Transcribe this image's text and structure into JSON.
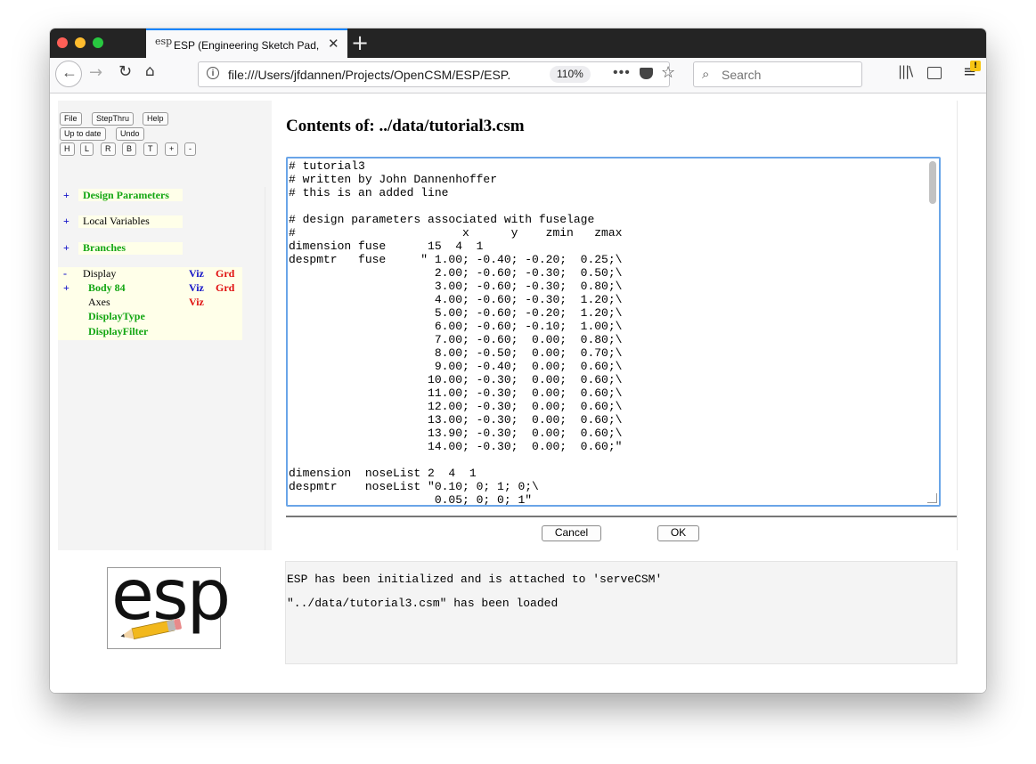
{
  "browser": {
    "tab_title": "ESP (Engineering Sketch Pad, V",
    "tab_favicon": "esp",
    "url": "file:///Users/jfdannen/Projects/OpenCSM/ESP/ESP.",
    "zoom": "110%",
    "search_placeholder": "Search",
    "icons": [
      "back-icon",
      "forward-icon",
      "reload-icon",
      "home-icon",
      "info-icon",
      "more-icon",
      "pocket-icon",
      "bookmark-star-icon",
      "search-icon",
      "library-icon",
      "sidebar-icon",
      "menu-icon"
    ]
  },
  "toolbar": {
    "row1": [
      "File",
      "StepThru",
      "Help"
    ],
    "row2": [
      "Up to date",
      "Undo"
    ],
    "row3": [
      "H",
      "L",
      "R",
      "B",
      "T",
      "+",
      "-"
    ]
  },
  "tree": {
    "design_parameters": {
      "toggle": "+",
      "label": "Design Parameters"
    },
    "local_variables": {
      "toggle": "+",
      "label": "Local Variables"
    },
    "branches": {
      "toggle": "+",
      "label": "Branches"
    },
    "display": {
      "toggle": "-",
      "label": "Display",
      "viz": "Viz",
      "grd": "Grd"
    },
    "body": {
      "toggle": "+",
      "label": "Body 84",
      "viz": "Viz",
      "grd": "Grd"
    },
    "axes": {
      "label": "Axes",
      "viz": "Viz"
    },
    "display_type": {
      "label": "DisplayType"
    },
    "display_filter": {
      "label": "DisplayFilter"
    }
  },
  "editor": {
    "heading": "Contents of: ../data/tutorial3.csm",
    "text": "# tutorial3\n# written by John Dannenhoffer\n# this is an added line\n\n# design parameters associated with fuselage\n#                        x      y    zmin   zmax\ndimension fuse      15  4  1\ndespmtr   fuse     \" 1.00; -0.40; -0.20;  0.25;\\\n                     2.00; -0.60; -0.30;  0.50;\\\n                     3.00; -0.60; -0.30;  0.80;\\\n                     4.00; -0.60; -0.30;  1.20;\\\n                     5.00; -0.60; -0.20;  1.20;\\\n                     6.00; -0.60; -0.10;  1.00;\\\n                     7.00; -0.60;  0.00;  0.80;\\\n                     8.00; -0.50;  0.00;  0.70;\\\n                     9.00; -0.40;  0.00;  0.60;\\\n                    10.00; -0.30;  0.00;  0.60;\\\n                    11.00; -0.30;  0.00;  0.60;\\\n                    12.00; -0.30;  0.00;  0.60;\\\n                    13.00; -0.30;  0.00;  0.60;\\\n                    13.90; -0.30;  0.00;  0.60;\\\n                    14.00; -0.30;  0.00;  0.60;\"\n\ndimension  noseList 2  4  1\ndespmtr    noseList \"0.10; 0; 1; 0;\\\n                     0.05; 0; 0; 1\"",
    "cancel_label": "Cancel",
    "ok_label": "OK"
  },
  "messages": [
    "ESP has been initialized and is attached to 'serveCSM'",
    "\"../data/tutorial3.csm\" has been loaded"
  ],
  "logo": {
    "text": "esp"
  },
  "colors": {
    "accent": "#0a84ff",
    "tree_green": "#13a613",
    "tree_blue": "#1414c8",
    "tree_red": "#e01010",
    "editor_focus": "#6aa5e8"
  }
}
